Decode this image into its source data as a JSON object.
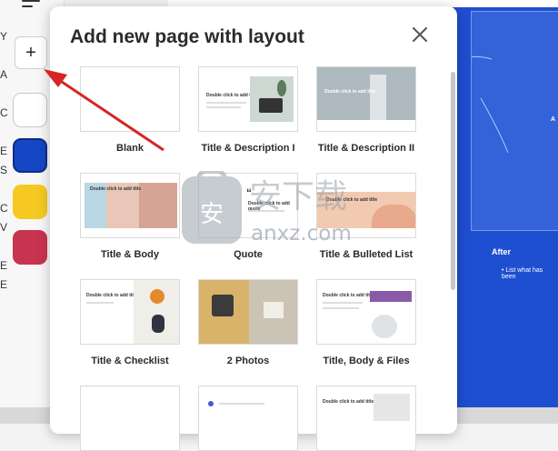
{
  "modal": {
    "title": "Add new page with layout",
    "close_icon": "close-icon"
  },
  "layouts": [
    {
      "label": "Blank"
    },
    {
      "label": "Title & Description I",
      "preview_title": "Double click to add title"
    },
    {
      "label": "Title & Description II",
      "preview_title": "Double click to add title"
    },
    {
      "label": "Title & Body",
      "preview_title": "Double click to add title"
    },
    {
      "label": "Quote",
      "preview_title": "Double click to add quote"
    },
    {
      "label": "Title & Bulleted List",
      "preview_title": "Double click to add title"
    },
    {
      "label": "Title & Checklist",
      "preview_title": "Double click to add title"
    },
    {
      "label": "2 Photos"
    },
    {
      "label": "Title, Body & Files",
      "preview_title": "Double click to add title"
    },
    {
      "label": ""
    },
    {
      "label": ""
    },
    {
      "label": "",
      "preview_title": "Double click to add title"
    }
  ],
  "sidebar": {
    "add_label": "+",
    "swatches": [
      {
        "name": "white",
        "color": "#ffffff"
      },
      {
        "name": "blue",
        "color": "#1546c4"
      },
      {
        "name": "yellow",
        "color": "#f6c922"
      },
      {
        "name": "crimson",
        "color": "#c8334f"
      }
    ],
    "edge_letters": [
      "Y",
      "",
      "A",
      "",
      "C",
      "",
      "E",
      "S",
      "",
      "C",
      "V",
      "",
      "E",
      "E"
    ]
  },
  "canvas": {
    "after_title": "After",
    "after_item": "List what has been",
    "deco_text": "A"
  },
  "watermark": {
    "text": "anxz.com"
  }
}
